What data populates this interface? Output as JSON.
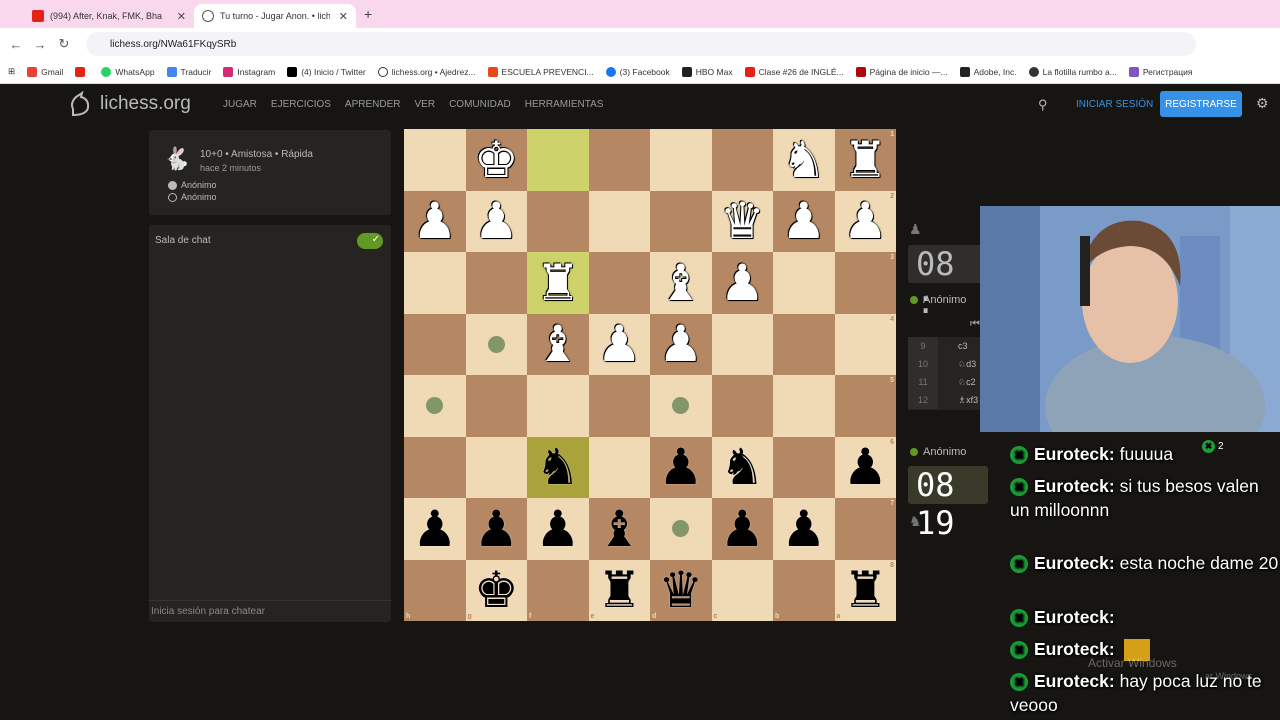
{
  "browser": {
    "tabs": [
      {
        "title": "(994) After, Knak, FMK, Bha",
        "active": false
      },
      {
        "title": "Tu turno - Jugar Anon. • liches",
        "active": true
      }
    ],
    "new_tab": "+",
    "url": "lichess.org/NWa61FKqySRb",
    "bookmarks": [
      "Gmail",
      "",
      "WhatsApp",
      "Traducir",
      "Instagram",
      "(4) Inicio / Twitter",
      "lichess.org • Ajedrez...",
      "ESCUELA PREVENCI...",
      "(3) Facebook",
      "HBO Max",
      "Clase #26 de INGLÉ...",
      "Página de inicio —...",
      "Adobe, Inc.",
      "La flotilla rumbo a...",
      "Регистрация"
    ]
  },
  "site": {
    "logo": "lichess.org",
    "nav": [
      "JUGAR",
      "EJERCICIOS",
      "APRENDER",
      "VER",
      "COMUNIDAD",
      "HERRAMIENTAS"
    ],
    "signin": "INICIAR SESIÓN",
    "register": "REGISTRARSE"
  },
  "game": {
    "type": "10+0 • Amistosa • Rápida",
    "time_ago": "hace 2 minutos",
    "players": [
      "Anónimo",
      "Anónimo"
    ]
  },
  "chat": {
    "title": "Sala de chat",
    "placeholder": "Inicia sesión para chatear"
  },
  "board": {
    "orientation": "black",
    "file_labels": [
      "h",
      "g",
      "f",
      "e",
      "d",
      "c",
      "b",
      "a"
    ],
    "rank_labels": [
      "1",
      "2",
      "3",
      "4",
      "5",
      "6",
      "7",
      "8"
    ],
    "rows": [
      [
        "",
        "wK",
        "",
        "",
        "",
        "",
        "wN",
        "wR"
      ],
      [
        "wP",
        "wP",
        "",
        "",
        "",
        "wQ",
        "wP",
        "wP"
      ],
      [
        "",
        "",
        "wR",
        "",
        "wB",
        "wP",
        "",
        ""
      ],
      [
        "",
        "",
        "wB",
        "wP",
        "wP",
        "",
        "",
        ""
      ],
      [
        "",
        "",
        "",
        "",
        "",
        "",
        "",
        ""
      ],
      [
        "",
        "",
        "bN",
        "",
        "bP",
        "bN",
        "",
        "bP"
      ],
      [
        "bP",
        "bP",
        "bP",
        "bB",
        "",
        "bP",
        "bP",
        ""
      ],
      [
        "",
        "bK",
        "",
        "bR",
        "bQ",
        "",
        "",
        "bR"
      ]
    ],
    "highlights": [
      [
        0,
        2
      ],
      [
        2,
        2
      ],
      [
        5,
        2
      ]
    ],
    "move_hints": [
      [
        3,
        1
      ],
      [
        4,
        0
      ],
      [
        4,
        4
      ],
      [
        6,
        4
      ]
    ]
  },
  "right_panel": {
    "top_clock": "08 :",
    "top_player": "Anónimo",
    "bottom_clock": "08 19",
    "bottom_player": "Anónimo",
    "moves": [
      {
        "n": "9",
        "m": "c3"
      },
      {
        "n": "10",
        "m": "♘d3"
      },
      {
        "n": "11",
        "m": "♘c2"
      },
      {
        "n": "12",
        "m": "♗xf3"
      }
    ]
  },
  "stream_chat": {
    "count": "2",
    "messages": [
      {
        "user": "Euroteck:",
        "text": "fuuuua"
      },
      {
        "user": "Euroteck:",
        "text": "si tus besos valen un milloonnn"
      },
      {
        "user": "Euroteck:",
        "text": "esta noche dame 20"
      },
      {
        "user": "Euroteck:",
        "text": ""
      },
      {
        "user": "Euroteck:",
        "text": ""
      },
      {
        "user": "Euroteck:",
        "text": "hay poca luz no te veooo"
      }
    ]
  },
  "watermark": {
    "line1": "Activar Windows",
    "line2": "ar Windows."
  },
  "colors": {
    "accent": "#3692e7",
    "board_light": "#f0d9b5",
    "board_dark": "#b58863",
    "toggle": "#629924"
  }
}
